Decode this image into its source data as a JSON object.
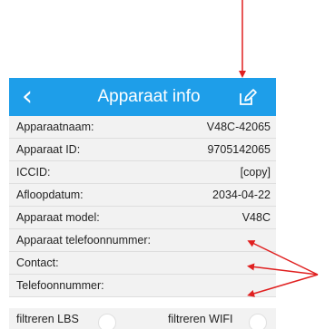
{
  "header": {
    "title": "Apparaat info",
    "back_icon": "chevron-left-icon",
    "edit_icon": "edit-icon",
    "background": "#1e9ee9"
  },
  "rows": [
    {
      "label": "Apparaatnaam:",
      "value": "V48C-42065"
    },
    {
      "label": "Apparaat ID:",
      "value": "9705142065"
    },
    {
      "label": "ICCID:",
      "value": "[copy]"
    },
    {
      "label": "Afloopdatum:",
      "value": "2034-04-22"
    },
    {
      "label": "Apparaat model:",
      "value": "V48C"
    },
    {
      "label": "Apparaat telefoonnummer:",
      "value": ""
    },
    {
      "label": "Contact:",
      "value": ""
    },
    {
      "label": "Telefoonnummer:",
      "value": ""
    }
  ],
  "filters": {
    "lbs_label": "filtreren LBS",
    "wifi_label": "filtreren WIFI"
  },
  "annotations": {
    "arrow_color": "#e02020"
  }
}
